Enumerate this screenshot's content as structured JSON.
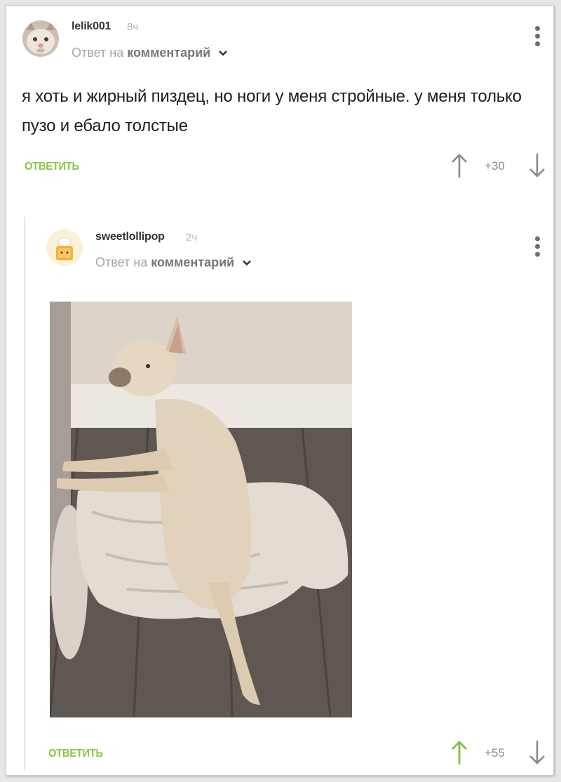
{
  "comments": [
    {
      "username": "lelik001",
      "time": "8ч",
      "reply_prefix": "Ответ на",
      "reply_target": "комментарий",
      "text": "я хоть и жирный пиздец, но ноги у меня стройные. у меня только пузо и ебало толстые",
      "reply_label": "ОТВЕТИТЬ",
      "rating": "+30"
    },
    {
      "username": "sweetlollipop",
      "time": "2ч",
      "reply_prefix": "Ответ на",
      "reply_target": "комментарий",
      "reply_label": "ОТВЕТИТЬ",
      "rating": "+55"
    }
  ],
  "colors": {
    "accent_green": "#8dc34a",
    "upvoted_arrow": "#7cc04a",
    "neutral_arrow": "#8a8a8a"
  },
  "icons": [
    "more-vertical-icon",
    "chevron-down-icon",
    "upvote-arrow-icon",
    "downvote-arrow-icon"
  ]
}
